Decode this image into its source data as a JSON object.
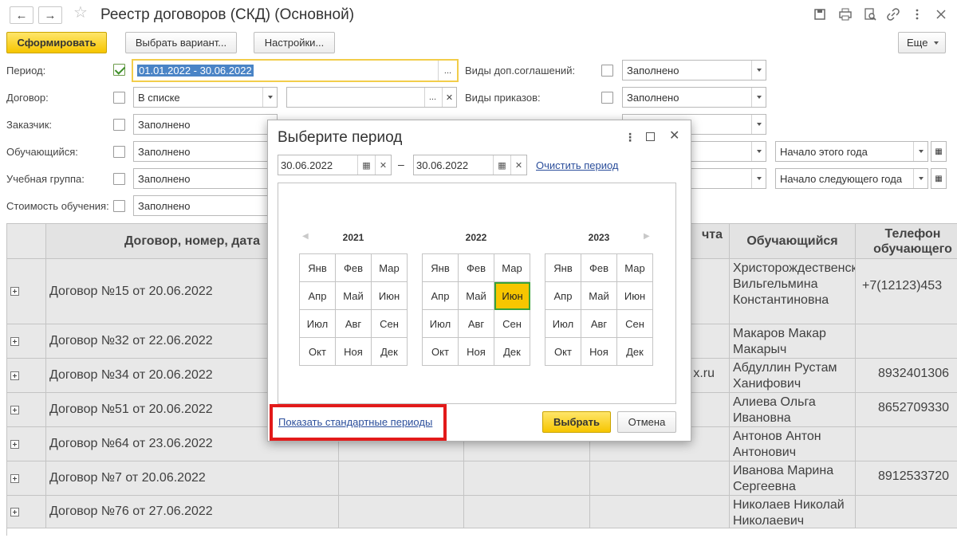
{
  "window": {
    "title": "Реестр договоров (СКД) (Основной)",
    "back_icon": "←",
    "forward_icon": "→",
    "favorite_icon": "☆"
  },
  "toolbar": {
    "generate": "Сформировать",
    "choose_variant": "Выбрать вариант...",
    "settings": "Настройки...",
    "more": "Еще"
  },
  "filters": {
    "period": {
      "label": "Период:",
      "value": "01.01.2022 - 30.06.2022",
      "checked": true
    },
    "contract": {
      "label": "Договор:",
      "value": "В списке"
    },
    "customer": {
      "label": "Заказчик:",
      "value": "Заполнено"
    },
    "student": {
      "label": "Обучающийся:",
      "value": "Заполнено"
    },
    "group": {
      "label": "Учебная группа:",
      "value": "Заполнено"
    },
    "cost": {
      "label": "Стоимость обучения:",
      "value": "Заполнено"
    },
    "agreements": {
      "label": "Виды доп.соглашений:",
      "value": "Заполнено"
    },
    "orders": {
      "label": "Виды приказов:",
      "value": "Заполнено"
    },
    "year_start": "Начало этого года",
    "next_year_start": "Начало следующего года"
  },
  "table": {
    "headers": {
      "contract": "Договор, номер, дата",
      "email": "чта",
      "student": "Обучающийся",
      "phone": "Телефон обучающего"
    },
    "rows": [
      {
        "contract": "Договор №15 от 20.06.2022",
        "email": "",
        "student": "Христорождественская Вильгельмина Константиновна",
        "phone": "+7(12123)453"
      },
      {
        "contract": "Договор №32 от 22.06.2022",
        "email": "",
        "student": "Макаров Макар Макарыч",
        "phone": ""
      },
      {
        "contract": "Договор №34 от 20.06.2022",
        "email": "x.ru",
        "student": "Абдуллин Рустам Ханифович",
        "phone": "8932401306"
      },
      {
        "contract": "Договор №51 от 20.06.2022",
        "email": "",
        "student": "Алиева Ольга Ивановна",
        "phone": "8652709330"
      },
      {
        "contract": "Договор №64 от 23.06.2022",
        "email": "",
        "student": "Антонов Антон Антонович",
        "phone": ""
      },
      {
        "contract": "Договор №7 от 20.06.2022",
        "email": "",
        "student": "Иванова Марина Сергеевна",
        "phone": "8912533720"
      },
      {
        "contract": "Договор №76 от 27.06.2022",
        "email": "",
        "student": "Николаев Николай Николаевич",
        "phone": ""
      }
    ]
  },
  "dialog": {
    "title": "Выберите период",
    "date_from": "30.06.2022",
    "date_to": "30.06.2022",
    "dash": "–",
    "clear_link": "Очистить период",
    "years": [
      "2021",
      "2022",
      "2023"
    ],
    "months": [
      "Янв",
      "Фев",
      "Мар",
      "Апр",
      "Май",
      "Июн",
      "Июл",
      "Авг",
      "Сен",
      "Окт",
      "Ноя",
      "Дек"
    ],
    "selected_year": "2022",
    "selected_month": "Июн",
    "show_standard_link": "Показать стандартные периоды",
    "select_button": "Выбрать",
    "cancel_button": "Отмена"
  },
  "colors": {
    "accent_yellow": "#f6c500",
    "highlight_red": "#e21a1a",
    "link_blue": "#2b4e9b",
    "selection_blue": "#4a84c6"
  }
}
